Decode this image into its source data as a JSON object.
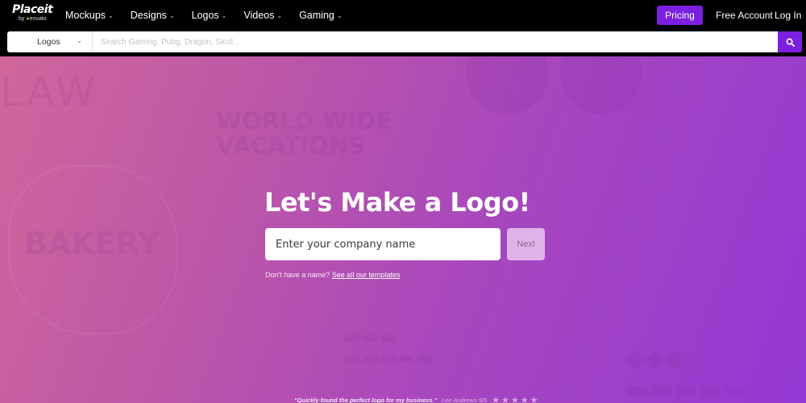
{
  "brand": {
    "name": "Placeit",
    "by": "by",
    "parent": "envato"
  },
  "nav": {
    "items": [
      {
        "label": "Mockups"
      },
      {
        "label": "Designs"
      },
      {
        "label": "Logos"
      },
      {
        "label": "Videos"
      },
      {
        "label": "Gaming"
      }
    ],
    "pricing": "Pricing",
    "free_account": "Free Account",
    "login": "Log In"
  },
  "search": {
    "category": "Logos",
    "placeholder": "Search Gaming, Pubg, Dragon, Skull...",
    "value": ""
  },
  "hero": {
    "title": "Let's Make a Logo!",
    "input_placeholder": "Enter your company name",
    "input_value": "",
    "next_label": "Next",
    "no_name_text": "Don't have a name?",
    "templates_link": "See all our templates",
    "background_texts": {
      "law": "LAW",
      "wwv_line1": "WORLD WIDE",
      "wwv_line2": "VACATIONS",
      "bakery": "BAKERY"
    }
  },
  "testimonial": {
    "quote": "\"Quickly found the perfect logo for my business.\"",
    "author": "Lee Andrews 5/5",
    "rating": 5,
    "max_rating": 5
  },
  "colors": {
    "accent": "#7b1fe0",
    "gradient_start": "#d0669a",
    "gradient_end": "#9438d4"
  }
}
